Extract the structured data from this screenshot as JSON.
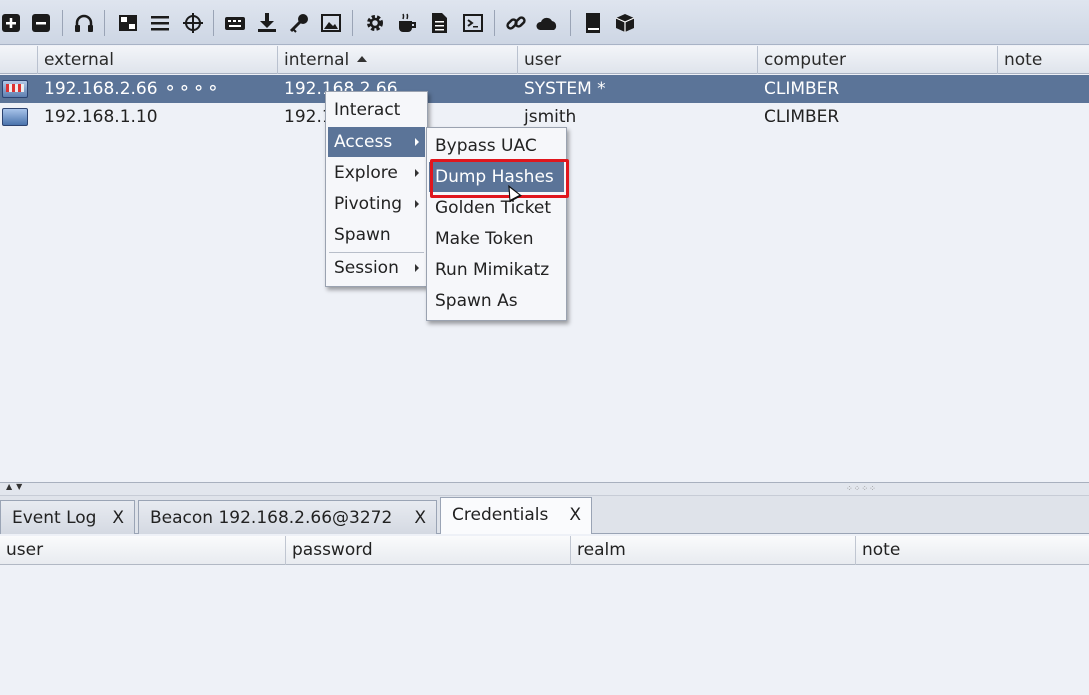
{
  "toolbar": {
    "icons": [
      "plus-icon",
      "minus-icon",
      "headphones-icon",
      "targets-icon",
      "list-icon",
      "crosshair-icon",
      "keyboard-icon",
      "download-icon",
      "key-icon",
      "image-icon",
      "gear-icon",
      "coffee-icon",
      "document-icon",
      "terminal-icon",
      "link-icon",
      "cloud-icon",
      "book-icon",
      "package-icon"
    ]
  },
  "targets_table": {
    "headers": {
      "external": "external",
      "internal": "internal",
      "user": "user",
      "computer": "computer",
      "note": "note"
    },
    "rows": [
      {
        "external": "192.168.2.66 ⚬⚬⚬⚬",
        "internal": "192.168.2.66",
        "user": "SYSTEM *",
        "computer": "CLIMBER"
      },
      {
        "external": "192.168.1.10",
        "internal": "192.1",
        "user": "jsmith",
        "computer": "CLIMBER"
      }
    ]
  },
  "context_menu": {
    "items": [
      "Interact",
      "Access",
      "Explore",
      "Pivoting",
      "Spawn",
      "Session"
    ]
  },
  "access_submenu": {
    "items": [
      "Bypass UAC",
      "Dump Hashes",
      "Golden Ticket",
      "Make Token",
      "Run Mimikatz",
      "Spawn As"
    ]
  },
  "tabs": {
    "event_log": "Event Log",
    "beacon": "Beacon 192.168.2.66@3272",
    "credentials": "Credentials",
    "close": "X"
  },
  "credentials_table": {
    "headers": {
      "user": "user",
      "password": "password",
      "realm": "realm",
      "note": "note"
    }
  },
  "colors": {
    "selection": "#5b7498",
    "highlight_box": "#e0161d"
  }
}
